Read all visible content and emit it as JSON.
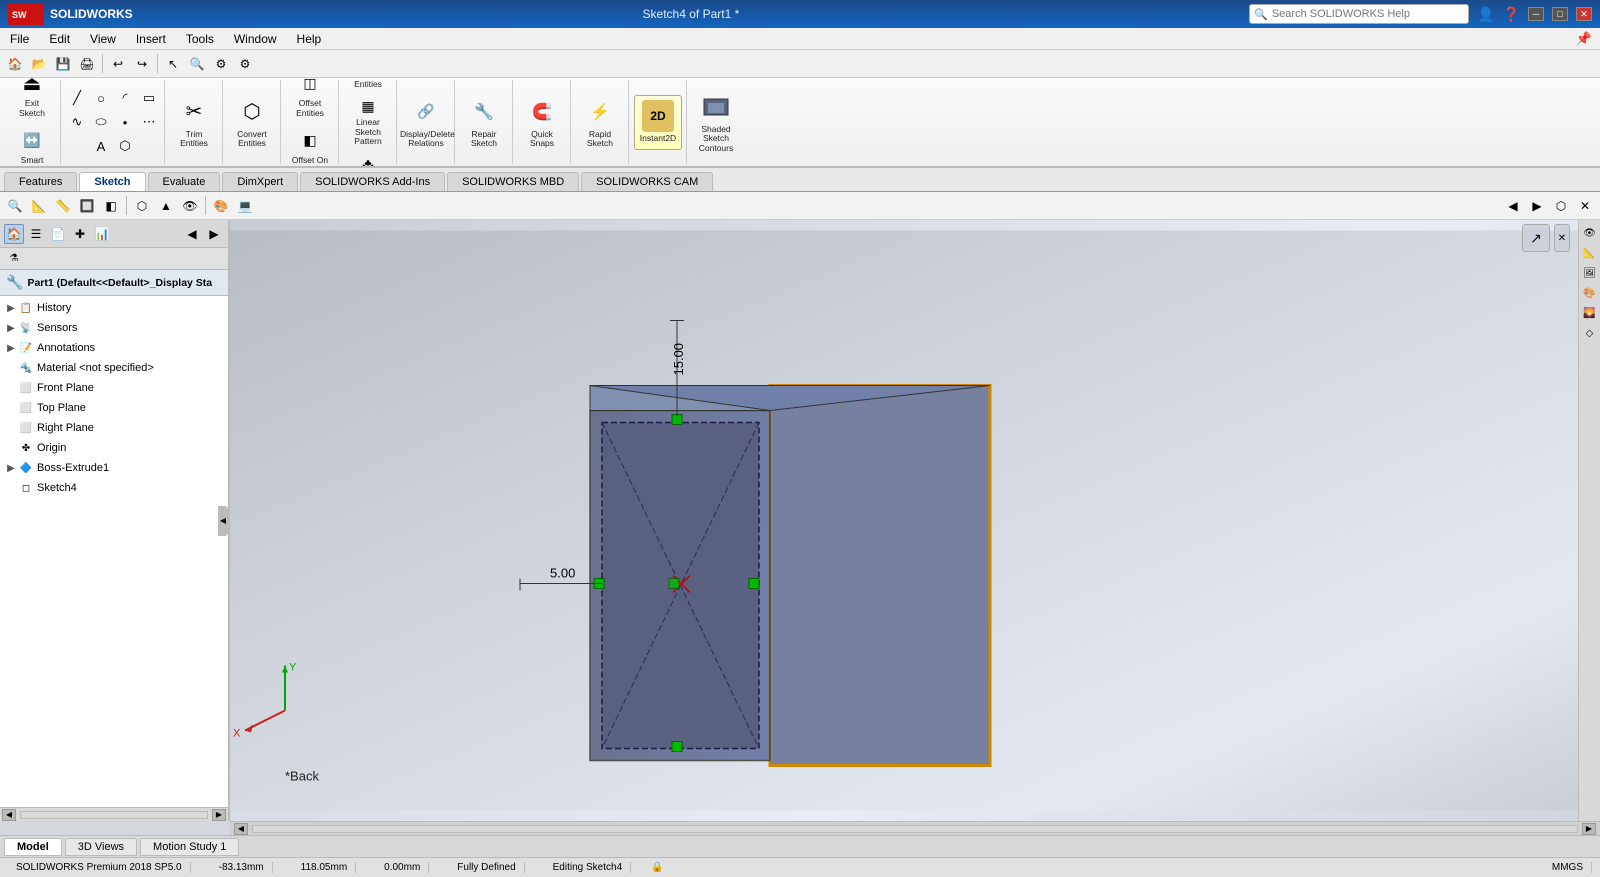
{
  "app": {
    "name": "SOLIDWORKS",
    "title": "Sketch4 of Part1 *",
    "version": "SOLIDWORKS Premium 2018 SP5.0"
  },
  "titlebar": {
    "logo": "SW",
    "title": "Sketch4 of Part1 *",
    "search_placeholder": "Search SOLIDWORKS Help",
    "min_label": "─",
    "max_label": "□",
    "close_label": "✕"
  },
  "menubar": {
    "items": [
      "File",
      "Edit",
      "View",
      "Insert",
      "Tools",
      "Window",
      "Help"
    ]
  },
  "sketch_toolbar": {
    "sections": [
      {
        "id": "exit",
        "buttons": [
          {
            "id": "exit-sketch",
            "label": "Exit Sketch",
            "icon": "⏏",
            "active": false
          },
          {
            "id": "smart-dimension",
            "label": "Smart Dimension",
            "icon": "↔",
            "active": false
          }
        ]
      },
      {
        "id": "lines",
        "buttons": []
      },
      {
        "id": "trim",
        "buttons": [
          {
            "id": "trim-entities",
            "label": "Trim Entities",
            "icon": "✂",
            "active": false
          }
        ]
      },
      {
        "id": "convert",
        "buttons": [
          {
            "id": "convert-entities",
            "label": "Convert Entities",
            "icon": "⬡",
            "active": false
          }
        ]
      },
      {
        "id": "offset",
        "buttons": [
          {
            "id": "offset-entities",
            "label": "Offset Entities",
            "icon": "◫",
            "active": false
          },
          {
            "id": "offset-surface",
            "label": "Offset On Surface",
            "icon": "◧",
            "active": false
          }
        ]
      },
      {
        "id": "mirror",
        "buttons": [
          {
            "id": "mirror-entities",
            "label": "Mirror Entities",
            "icon": "⧈",
            "active": false
          },
          {
            "id": "linear-sketch-pattern",
            "label": "Linear Sketch Pattern",
            "icon": "▦",
            "active": false
          },
          {
            "id": "move-entities",
            "label": "Move Entities",
            "icon": "✥",
            "active": false
          }
        ]
      },
      {
        "id": "display",
        "buttons": [
          {
            "id": "display-delete-relations",
            "label": "Display/Delete Relations",
            "icon": "🔗",
            "active": false
          }
        ]
      },
      {
        "id": "repair",
        "buttons": [
          {
            "id": "repair-sketch",
            "label": "Repair Sketch",
            "icon": "🔧",
            "active": false
          }
        ]
      },
      {
        "id": "quick-snaps",
        "buttons": [
          {
            "id": "quick-snaps",
            "label": "Quick Snaps",
            "icon": "🧲",
            "active": false
          }
        ]
      },
      {
        "id": "rapid2d",
        "buttons": [
          {
            "id": "rapid-sketch",
            "label": "Rapid Sketch",
            "icon": "⚡",
            "active": false
          }
        ]
      },
      {
        "id": "instant2d",
        "buttons": [
          {
            "id": "instant2d",
            "label": "Instant2D",
            "icon": "2D",
            "active": true
          }
        ]
      },
      {
        "id": "shaded",
        "buttons": [
          {
            "id": "shaded-sketch-contours",
            "label": "Shaded Sketch Contours",
            "icon": "◼",
            "active": false
          }
        ]
      }
    ]
  },
  "tabs": {
    "main": [
      "Features",
      "Sketch",
      "Evaluate",
      "DimXpert",
      "SOLIDWORKS Add-Ins",
      "SOLIDWORKS MBD",
      "SOLIDWORKS CAM"
    ],
    "active": "Sketch"
  },
  "secondary_toolbar": {
    "icons": [
      "🔍",
      "📐",
      "📏",
      "🔲",
      "🔷",
      "⬡",
      "▲",
      "👁",
      "🎨",
      "💻"
    ]
  },
  "left_panel": {
    "toolbar_icons": [
      "🏠",
      "☰",
      "📄",
      "✚",
      "📊",
      "◀",
      "▶"
    ],
    "filter_icon": "⚗",
    "part_header": "Part1 (Default<<Default>_Display Sta",
    "tree_items": [
      {
        "id": "history",
        "label": "History",
        "icon": "📋",
        "indent": 1,
        "expandable": true
      },
      {
        "id": "sensors",
        "label": "Sensors",
        "icon": "📡",
        "indent": 1,
        "expandable": true
      },
      {
        "id": "annotations",
        "label": "Annotations",
        "icon": "📝",
        "indent": 1,
        "expandable": true
      },
      {
        "id": "material",
        "label": "Material <not specified>",
        "icon": "🔩",
        "indent": 1,
        "expandable": false
      },
      {
        "id": "front-plane",
        "label": "Front Plane",
        "icon": "⬜",
        "indent": 1,
        "expandable": false
      },
      {
        "id": "top-plane",
        "label": "Top Plane",
        "icon": "⬜",
        "indent": 1,
        "expandable": false
      },
      {
        "id": "right-plane",
        "label": "Right Plane",
        "icon": "⬜",
        "indent": 1,
        "expandable": false
      },
      {
        "id": "origin",
        "label": "Origin",
        "icon": "✤",
        "indent": 1,
        "expandable": false
      },
      {
        "id": "boss-extrude1",
        "label": "Boss-Extrude1",
        "icon": "🔷",
        "indent": 1,
        "expandable": true
      },
      {
        "id": "sketch4",
        "label": "Sketch4",
        "icon": "◻",
        "indent": 1,
        "expandable": false
      }
    ]
  },
  "canvas": {
    "dim1": "15.00",
    "dim2": "5.00",
    "view_label": "*Back"
  },
  "statusbar": {
    "coordinates": "-83.13mm",
    "y_coord": "118.05mm",
    "z_coord": "0.00mm",
    "status": "Fully Defined",
    "editing": "Editing Sketch4",
    "lock_icon": "🔒",
    "units": "MMGS"
  },
  "bottom_tabs": {
    "items": [
      "Model",
      "3D Views",
      "Motion Study 1"
    ],
    "active": "Model"
  },
  "colors": {
    "accent_blue": "#1565c0",
    "sketch_face": "#5a6080",
    "sketch_border": "#cc8800",
    "dim_line": "#000000",
    "green_constraint": "#00cc00",
    "red_cross": "#cc0000"
  }
}
